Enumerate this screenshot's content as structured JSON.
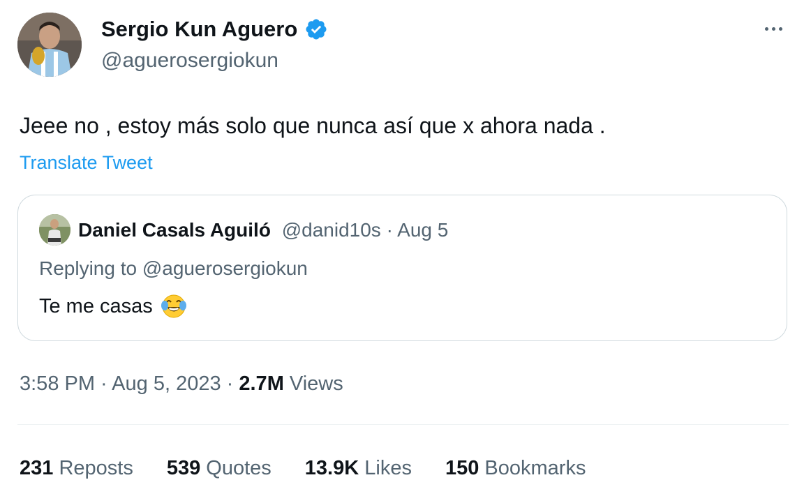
{
  "author": {
    "name": "Sergio Kun Aguero",
    "handle": "@aguerosergiokun",
    "verified_color": "#1d9bf0"
  },
  "tweet": {
    "text": "Jeee no , estoy más solo que nunca así que x ahora nada .",
    "translate_label": "Translate Tweet"
  },
  "quote": {
    "name": "Daniel Casals Aguiló",
    "handle": "@danid10s",
    "separator": " · ",
    "date": "Aug 5",
    "replying_to": "Replying to @aguerosergiokun",
    "text": "Te me casas",
    "emoji": "face-with-tears-of-joy"
  },
  "meta": {
    "time": "3:58 PM",
    "sep1": " · ",
    "date": "Aug 5, 2023",
    "sep2": " · ",
    "views_count": "2.7M",
    "views_label": "Views"
  },
  "stats": {
    "reposts_count": "231",
    "reposts_label": "Reposts",
    "quotes_count": "539",
    "quotes_label": "Quotes",
    "likes_count": "13.9K",
    "likes_label": "Likes",
    "bookmarks_count": "150",
    "bookmarks_label": "Bookmarks"
  },
  "colors": {
    "accent": "#1d9bf0",
    "secondary_text": "#536471",
    "border": "#cfd9de"
  }
}
